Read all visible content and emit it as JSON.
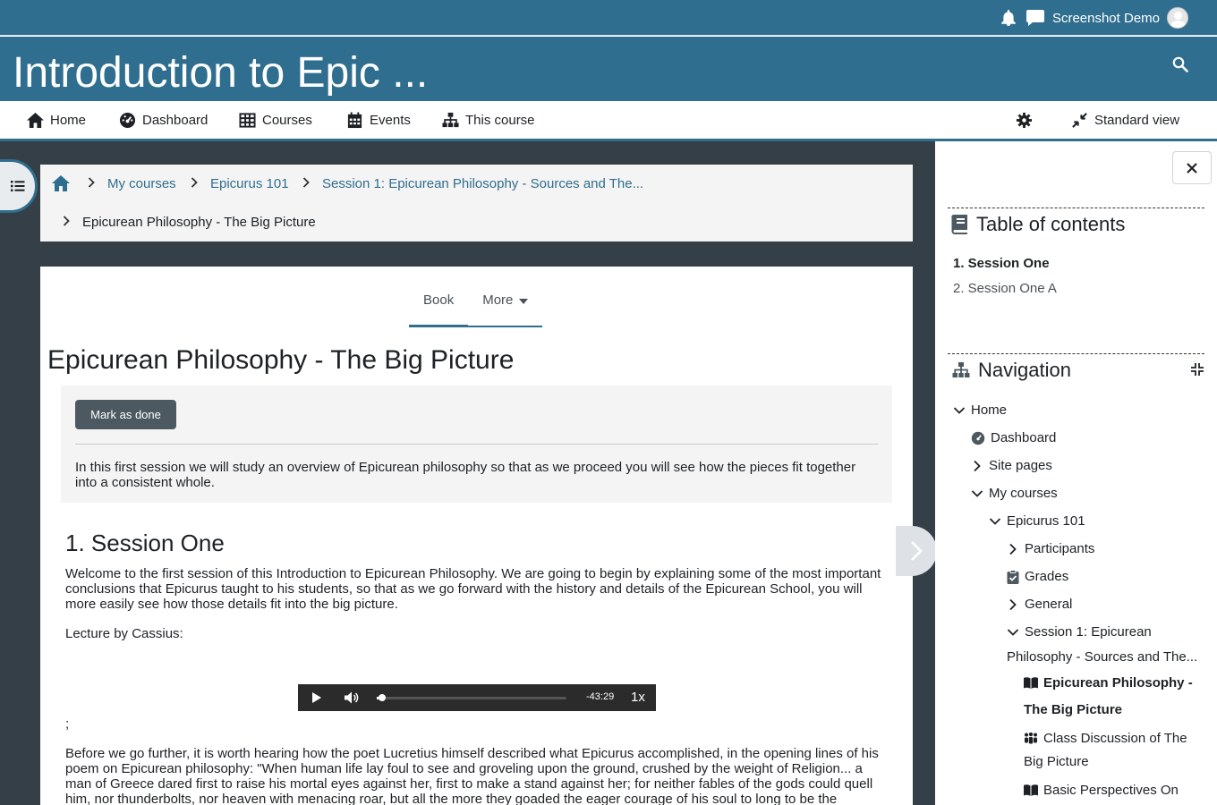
{
  "topbar": {
    "user_name": "Screenshot Demo"
  },
  "banner": {
    "course_title": "Introduction to Epic ..."
  },
  "nav": {
    "home": "Home",
    "dashboard": "Dashboard",
    "courses": "Courses",
    "events": "Events",
    "this_course": "This course",
    "standard_view": "Standard view"
  },
  "breadcrumb": {
    "my_courses": "My courses",
    "course": "Epicurus 101",
    "session": "Session 1: Epicurean Philosophy - Sources and The...",
    "current": "Epicurean Philosophy - The Big Picture"
  },
  "tabs": {
    "book": "Book",
    "more": "More"
  },
  "page": {
    "title": "Epicurean Philosophy - The Big Picture",
    "mark_done": "Mark as done",
    "intro": "In this first session we will study an overview of Epicurean philosophy so that as we proceed you will see how the pieces fit together into a consistent whole.",
    "section_title": "1. Session One",
    "para1": "Welcome to the first session of this Introduction to Epicurean Philosophy.  We are going to begin by explaining some of the most important conclusions that Epicurus taught to his students, so that as we go forward with the history and details of the Epicurean School, you will more easily see how those details fit into the big picture.",
    "lecture": "Lecture by Cassius:",
    "semicolon": ";",
    "para2": "Before we go further, it is worth hearing how the poet Lucretius himself described what Epicurus accomplished, in the opening lines of his poem on Epicurean philosophy: \"When human life lay foul to see and groveling upon the ground, crushed by the weight of Religion... a man of Greece dared first to raise his mortal eyes against her, first to make a stand against her; for neither fables of the gods could quell him, nor thunderbolts, nor heaven with menacing roar, but all the more they goaded the eager courage of his soul to long to be the"
  },
  "player": {
    "time": "-43:29",
    "speed": "1x",
    "progress": 0.02
  },
  "toc": {
    "title": "Table of contents",
    "items": [
      "1. Session One",
      "2. Session One A"
    ]
  },
  "navigation": {
    "title": "Navigation",
    "home": "Home",
    "dashboard": "Dashboard",
    "site_pages": "Site pages",
    "my_courses": "My courses",
    "course": "Epicurus 101",
    "participants": "Participants",
    "grades": "Grades",
    "general": "General",
    "session_line1": "Session 1: Epicurean",
    "session_line2": "Philosophy - Sources and The...",
    "book_line1": "Epicurean Philosophy -",
    "book_line2": "The Big Picture",
    "forum_line1": "Class Discussion of The",
    "forum_line2": "Big Picture",
    "book2_line1": "Basic Perspectives On"
  },
  "colors": {
    "brand": "#2f6e8f",
    "dark_bg": "#353f47"
  }
}
